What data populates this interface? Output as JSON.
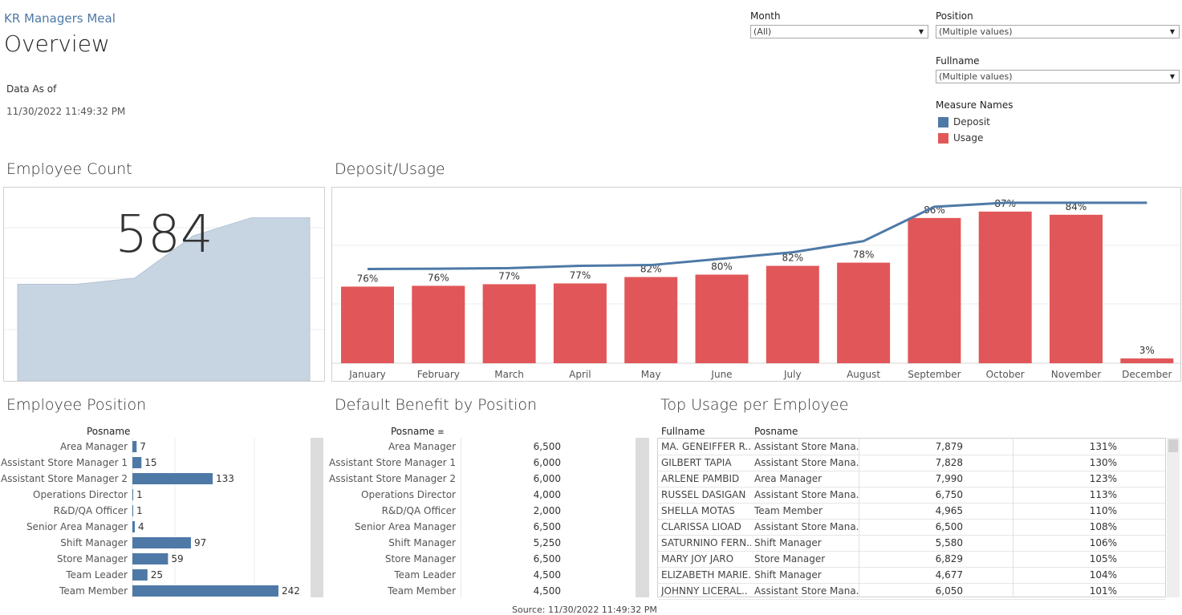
{
  "header": {
    "app_name": "KR Managers Meal",
    "page_title": "Overview",
    "data_as_of_label": "Data As of",
    "data_as_of_value": "11/30/2022 11:49:32 PM"
  },
  "filters": {
    "month": {
      "label": "Month",
      "value": "(All)"
    },
    "position": {
      "label": "Position",
      "value": "(Multiple values)"
    },
    "fullname": {
      "label": "Fullname",
      "value": "(Multiple values)"
    }
  },
  "legend": {
    "title": "Measure Names",
    "items": [
      {
        "label": "Deposit",
        "color": "#4e79a7"
      },
      {
        "label": "Usage",
        "color": "#e15759"
      }
    ]
  },
  "employee_count": {
    "title": "Employee Count",
    "value": "584"
  },
  "deposit_usage": {
    "title": "Deposit/Usage"
  },
  "employee_position": {
    "title": "Employee Position",
    "header": "Posname"
  },
  "default_benefit": {
    "title": "Default Benefit by Position",
    "header": "Posname",
    "rows": [
      {
        "posname": "Area Manager",
        "value": "6,500"
      },
      {
        "posname": "Assistant Store Manager 1",
        "value": "6,000"
      },
      {
        "posname": "Assistant Store Manager 2",
        "value": "6,000"
      },
      {
        "posname": "Operations Director",
        "value": "4,000"
      },
      {
        "posname": "R&D/QA Officer",
        "value": "2,000"
      },
      {
        "posname": "Senior Area Manager",
        "value": "6,500"
      },
      {
        "posname": "Shift Manager",
        "value": "5,250"
      },
      {
        "posname": "Store Manager",
        "value": "6,500"
      },
      {
        "posname": "Team Leader",
        "value": "4,500"
      },
      {
        "posname": "Team Member",
        "value": "4,500"
      }
    ]
  },
  "top_usage": {
    "title": "Top Usage per Employee",
    "headers": [
      "Fullname",
      "Posname"
    ],
    "rows": [
      {
        "fullname": "MA. GENEIFFER R...",
        "posname": "Assistant Store Mana..",
        "amount": "7,879",
        "pct": "131%"
      },
      {
        "fullname": "GILBERT TAPIA",
        "posname": "Assistant Store Mana..",
        "amount": "7,828",
        "pct": "130%"
      },
      {
        "fullname": "ARLENE PAMBID",
        "posname": "Area Manager",
        "amount": "7,990",
        "pct": "123%"
      },
      {
        "fullname": "RUSSEL DASIGAN",
        "posname": "Assistant Store Mana..",
        "amount": "6,750",
        "pct": "113%"
      },
      {
        "fullname": "SHELLA MOTAS",
        "posname": "Team Member",
        "amount": "4,965",
        "pct": "110%"
      },
      {
        "fullname": "CLARISSA LIOAD",
        "posname": "Assistant Store Mana..",
        "amount": "6,500",
        "pct": "108%"
      },
      {
        "fullname": "SATURNINO FERN..",
        "posname": "Shift Manager",
        "amount": "5,580",
        "pct": "106%"
      },
      {
        "fullname": "MARY JOY JARO",
        "posname": "Store Manager",
        "amount": "6,829",
        "pct": "105%"
      },
      {
        "fullname": "ELIZABETH MARIE..",
        "posname": "Shift Manager",
        "amount": "4,677",
        "pct": "104%"
      },
      {
        "fullname": "JOHNNY LICERAL..",
        "posname": "Assistant Store Mana..",
        "amount": "6,050",
        "pct": "101%"
      }
    ]
  },
  "footer": {
    "text": "Source: 11/30/2022 11:49:32 PM"
  },
  "chart_data": [
    {
      "type": "area",
      "name": "employee-count-trend",
      "x": [
        1,
        2,
        3,
        4,
        5,
        6
      ],
      "values": [
        520,
        520,
        525,
        560,
        575,
        575
      ],
      "ylim": [
        440,
        600
      ],
      "grid": true
    },
    {
      "type": "bar",
      "categories": [
        "January",
        "February",
        "March",
        "April",
        "May",
        "June",
        "July",
        "August",
        "September",
        "October",
        "November",
        "December"
      ],
      "series": [
        {
          "name": "Usage",
          "color": "#e15759",
          "values": [
            4800,
            4850,
            4950,
            5000,
            5400,
            5550,
            6100,
            6300,
            9100,
            9500,
            9300,
            300
          ]
        },
        {
          "name": "Deposit",
          "color": "#4e79a7",
          "values": [
            5900,
            5920,
            5960,
            6100,
            6150,
            6550,
            6950,
            7650,
            9800,
            10050,
            10050,
            10050
          ]
        }
      ],
      "data_labels": [
        "76%",
        "76%",
        "77%",
        "77%",
        "82%",
        "80%",
        "82%",
        "78%",
        "86%",
        "87%",
        "84%",
        "3%"
      ],
      "ylim": [
        0,
        11000
      ],
      "grid": true
    },
    {
      "type": "bar",
      "orientation": "horizontal",
      "categories": [
        "Area Manager",
        "Assistant Store Manager 1",
        "Assistant Store Manager 2",
        "Operations Director",
        "R&D/QA Officer",
        "Senior Area Manager",
        "Shift Manager",
        "Store Manager",
        "Team Leader",
        "Team Member"
      ],
      "values": [
        7,
        15,
        133,
        1,
        1,
        4,
        97,
        59,
        25,
        242
      ],
      "color": "#4e79a7",
      "xlim": [
        0,
        290
      ]
    }
  ]
}
